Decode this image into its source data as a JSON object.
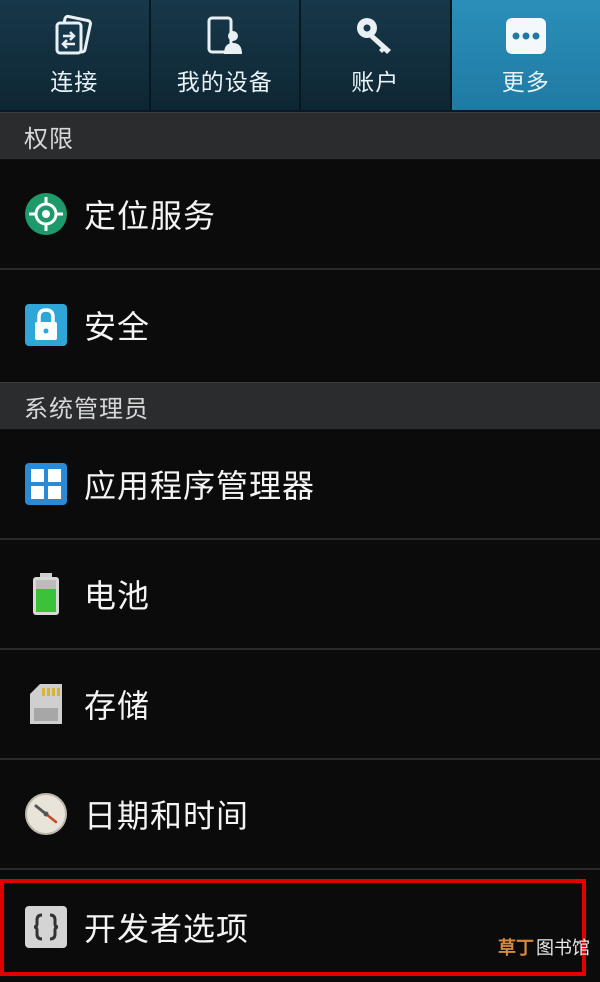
{
  "tabs": [
    {
      "label": "连接",
      "icon": "connections-icon",
      "active": false
    },
    {
      "label": "我的设备",
      "icon": "my-device-icon",
      "active": false
    },
    {
      "label": "账户",
      "icon": "key-icon",
      "active": false
    },
    {
      "label": "更多",
      "icon": "more-icon",
      "active": true
    }
  ],
  "sections": {
    "permissions": {
      "title": "权限"
    },
    "system_admin": {
      "title": "系统管理员"
    }
  },
  "items": {
    "location": {
      "label": "定位服务",
      "icon": "location-icon"
    },
    "security": {
      "label": "安全",
      "icon": "lock-icon"
    },
    "app_manager": {
      "label": "应用程序管理器",
      "icon": "app-grid-icon"
    },
    "battery": {
      "label": "电池",
      "icon": "battery-icon"
    },
    "storage": {
      "label": "存储",
      "icon": "sd-card-icon"
    },
    "date_time": {
      "label": "日期和时间",
      "icon": "clock-icon"
    },
    "developer": {
      "label": "开发者选项",
      "icon": "braces-icon"
    }
  },
  "watermark": {
    "part1": "草丁",
    "part2": "图书馆"
  },
  "colors": {
    "active_tab": "#2b8fb9",
    "highlight": "#e00000"
  }
}
